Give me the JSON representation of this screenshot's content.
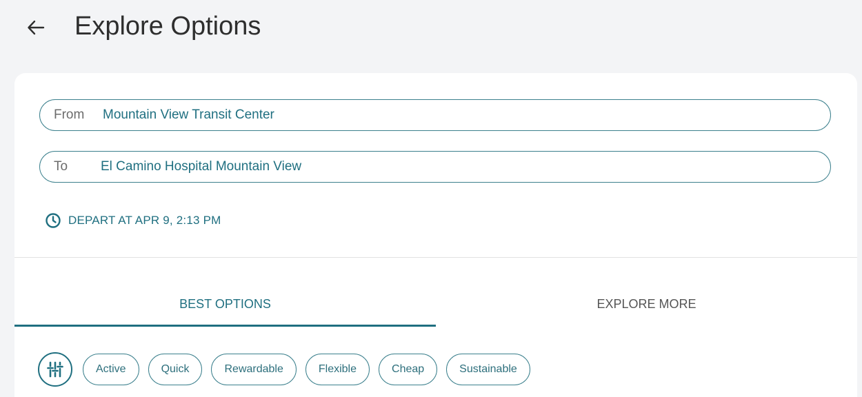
{
  "header": {
    "title": "Explore Options"
  },
  "search": {
    "from_label": "From",
    "from_value": "Mountain View Transit Center",
    "to_label": "To",
    "to_value": "El Camino Hospital Mountain View"
  },
  "depart": {
    "label": "DEPART AT APR 9, 2:13 PM"
  },
  "tabs": [
    {
      "label": "BEST OPTIONS",
      "active": true
    },
    {
      "label": "EXPLORE MORE",
      "active": false
    }
  ],
  "filters": {
    "icon": "sliders-icon",
    "chips": [
      "Active",
      "Quick",
      "Rewardable",
      "Flexible",
      "Cheap",
      "Sustainable"
    ]
  },
  "colors": {
    "accent": "#1f6f80",
    "background": "#f3f4f6",
    "card": "#ffffff"
  }
}
